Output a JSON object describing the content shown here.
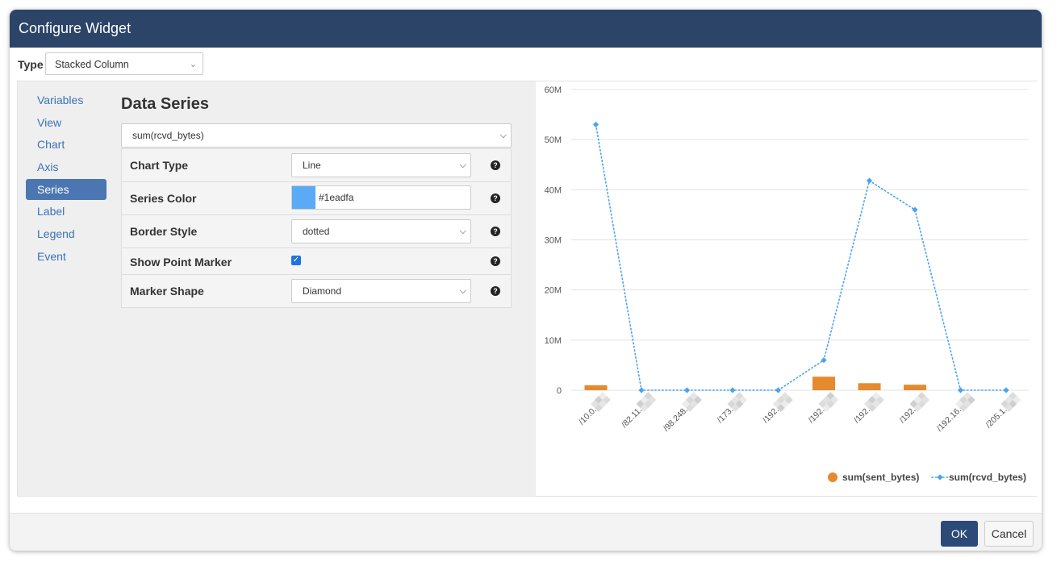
{
  "dialog": {
    "title": "Configure Widget"
  },
  "type_row": {
    "label": "Type",
    "value": "Stacked Column"
  },
  "nav": {
    "items": [
      "Variables",
      "View",
      "Chart",
      "Axis",
      "Series",
      "Label",
      "Legend",
      "Event"
    ],
    "active": "Series"
  },
  "data_series": {
    "title": "Data Series",
    "selected_series": "sum(rcvd_bytes)",
    "properties": {
      "chart_type": {
        "label": "Chart Type",
        "value": "Line"
      },
      "series_color": {
        "label": "Series Color",
        "value": "#1eadfa",
        "swatch": "#5aaaf6"
      },
      "border_style": {
        "label": "Border Style",
        "value": "dotted"
      },
      "show_point_marker": {
        "label": "Show Point Marker",
        "checked": true
      },
      "marker_shape": {
        "label": "Marker Shape",
        "value": "Diamond"
      }
    },
    "help_icon": "question-circle-icon"
  },
  "footer": {
    "ok_label": "OK",
    "cancel_label": "Cancel"
  },
  "colors": {
    "titlebar": "#2b4468",
    "active_nav": "#4b76b2",
    "sent_bytes": "#e68a2e",
    "rcvd_bytes": "#4aa3ee"
  },
  "chart_data": {
    "type": "bar",
    "categories": [
      "/10.0...",
      "/82.11...",
      "/98.248...",
      "/173...",
      "/192...",
      "/192...",
      "/192...",
      "/192...",
      "/192.16...",
      "/205.1..."
    ],
    "ylim": [
      0,
      60000000
    ],
    "yticks": [
      "0",
      "10M",
      "20M",
      "30M",
      "40M",
      "50M",
      "60M"
    ],
    "grid": true,
    "legend_position": "bottom-right",
    "series": [
      {
        "name": "sum(sent_bytes)",
        "type": "bar",
        "color": "#e68a2e",
        "values": [
          1000000,
          0,
          0,
          0,
          0,
          2700000,
          1400000,
          1100000,
          0,
          0
        ]
      },
      {
        "name": "sum(rcvd_bytes)",
        "type": "line",
        "style": "dotted",
        "marker": "diamond",
        "color": "#4aa3ee",
        "values": [
          53000000,
          0,
          0,
          0,
          0,
          6000000,
          41800000,
          36000000,
          0,
          0
        ]
      }
    ]
  }
}
